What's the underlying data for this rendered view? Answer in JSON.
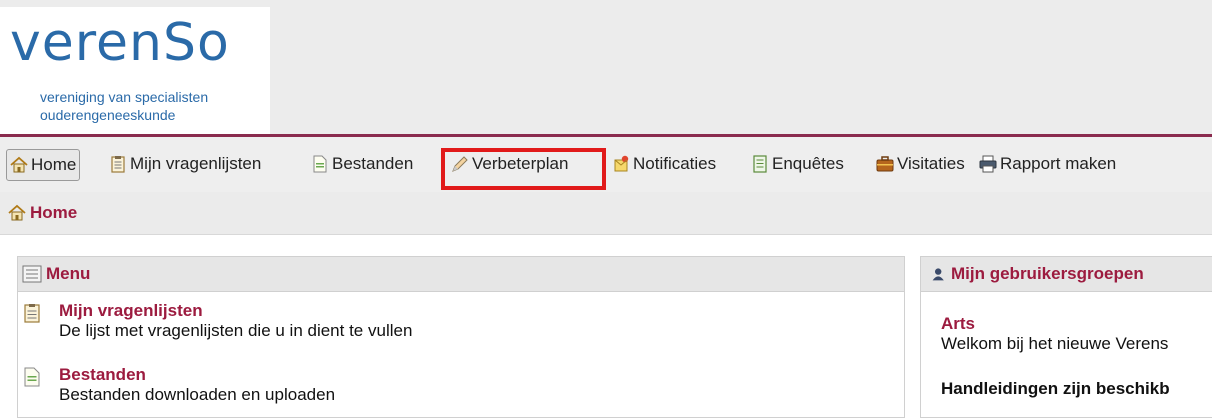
{
  "brand": {
    "logo_text": "verenSo",
    "tagline_line1": "vereniging van specialisten",
    "tagline_line2": "ouderengeneeskunde",
    "accent": "#9c1b3f",
    "logo_color": "#2a6aa8"
  },
  "nav": {
    "items": [
      {
        "label": "Home",
        "icon": "home-icon"
      },
      {
        "label": "Mijn vragenlijsten",
        "icon": "clipboard-icon"
      },
      {
        "label": "Bestanden",
        "icon": "file-icon"
      },
      {
        "label": "Verbeterplan",
        "icon": "pencil-icon",
        "highlighted": true
      },
      {
        "label": "Notificaties",
        "icon": "notification-icon"
      },
      {
        "label": "Enquêtes",
        "icon": "survey-icon"
      },
      {
        "label": "Visitaties",
        "icon": "briefcase-icon"
      },
      {
        "label": "Rapport maken",
        "icon": "printer-icon"
      }
    ]
  },
  "breadcrumb": {
    "label": "Home",
    "icon": "home-icon"
  },
  "menu_panel": {
    "title": "Menu",
    "entries": [
      {
        "title": "Mijn vragenlijsten",
        "desc": "De lijst met vragenlijsten die u in dient te vullen"
      },
      {
        "title": "Bestanden",
        "desc": "Bestanden downloaden en uploaden"
      }
    ]
  },
  "groups_panel": {
    "title": "Mijn gebruikersgroepen",
    "group_name": "Arts",
    "welcome": "Welkom bij het nieuwe Verens",
    "manuals": "Handleidingen zijn beschikb"
  }
}
